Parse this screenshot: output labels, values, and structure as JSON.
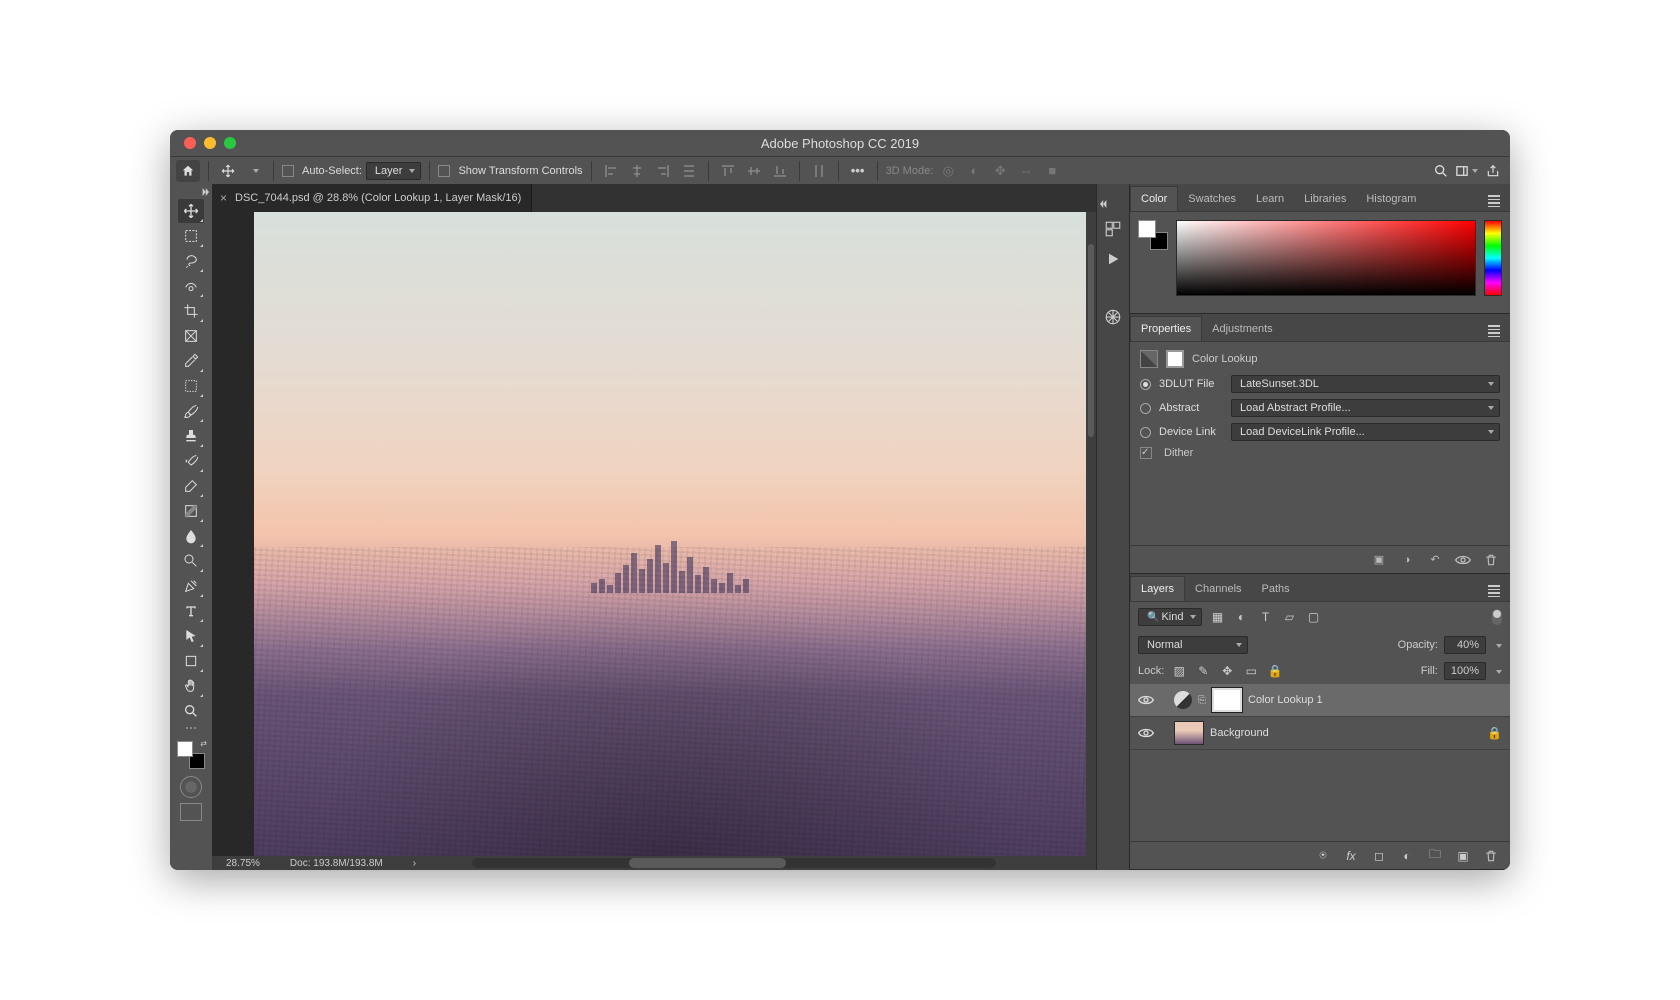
{
  "titlebar": {
    "title": "Adobe Photoshop CC 2019"
  },
  "options": {
    "auto_select_label": "Auto-Select:",
    "auto_select_value": "Layer",
    "transform_label": "Show Transform Controls",
    "mode3d_label": "3D Mode:"
  },
  "document": {
    "tab_title": "DSC_7044.psd @ 28.8% (Color Lookup 1, Layer Mask/16)",
    "zoom": "28.75%",
    "docinfo": "Doc: 193.8M/193.8M"
  },
  "panels": {
    "color": {
      "tabs": [
        "Color",
        "Swatches",
        "Learn",
        "Libraries",
        "Histogram"
      ],
      "active": 0
    },
    "properties": {
      "tabs": [
        "Properties",
        "Adjustments"
      ],
      "active": 0,
      "title": "Color Lookup",
      "rows": {
        "lut_label": "3DLUT File",
        "lut_value": "LateSunset.3DL",
        "abstract_label": "Abstract",
        "abstract_value": "Load Abstract Profile...",
        "device_label": "Device Link",
        "device_value": "Load DeviceLink Profile...",
        "dither_label": "Dither"
      }
    },
    "layers": {
      "tabs": [
        "Layers",
        "Channels",
        "Paths"
      ],
      "active": 0,
      "filter_kind": "Kind",
      "blend_mode": "Normal",
      "opacity_label": "Opacity:",
      "opacity_value": "40%",
      "lock_label": "Lock:",
      "fill_label": "Fill:",
      "fill_value": "100%",
      "items": [
        {
          "name": "Color Lookup 1",
          "type": "adjustment",
          "selected": true
        },
        {
          "name": "Background",
          "type": "image",
          "locked": true
        }
      ]
    }
  }
}
